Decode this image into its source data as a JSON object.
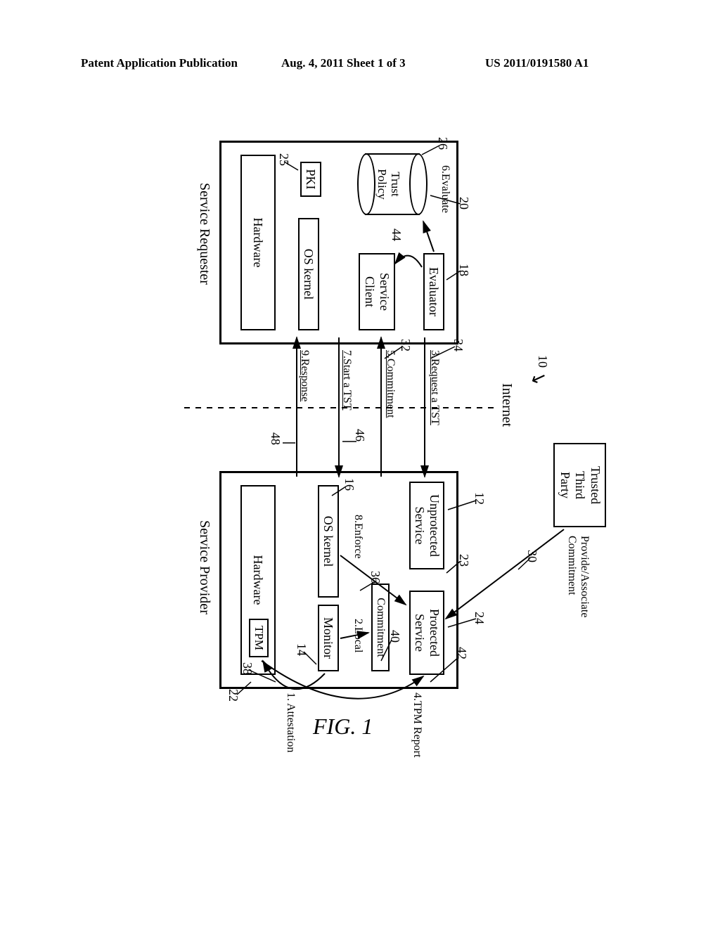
{
  "header": {
    "left": "Patent Application Publication",
    "center": "Aug. 4, 2011  Sheet 1 of 3",
    "right": "US 2011/0191580 A1"
  },
  "figure_label": "FIG. 1",
  "ref_num_10": "10",
  "boxes": {
    "ttp": "Trusted\nThird\nParty",
    "evaluator": "Evaluator",
    "service_client": "Service\nClient",
    "req_os": "OS kernel",
    "req_hw": "Hardware",
    "pki": "PKI",
    "trust_policy": "Trust\nPolicy",
    "unprotected": "Unprotected\nService",
    "protected": "Protected\nService",
    "commitment": "Commitment",
    "sp_os": "OS kernel",
    "monitor": "Monitor",
    "sp_hw": "Hardware",
    "tpm": "TPM"
  },
  "labels": {
    "service_requester": "Service Requester",
    "service_provider": "Service Provider",
    "internet": "Internet"
  },
  "steps": {
    "s1": "1. Attestation",
    "s2": "2.Local",
    "s3": "3.Request a TST",
    "s4": "4.TPM Report",
    "s5": "5.Commitment",
    "s6": "6.Evaluate",
    "s7": "7.Start a TST",
    "s8": "8.Enforce",
    "s9": "9.Response",
    "s30": "Provide/Associate\nCommitment"
  },
  "nums": {
    "n10": "10",
    "n12": "12",
    "n14": "14",
    "n16": "16",
    "n18": "18",
    "n20": "20",
    "n22": "22",
    "n23": "23",
    "n24": "24",
    "n25": "25",
    "n26": "26",
    "n30": "30",
    "n32": "32",
    "n34": "34",
    "n36": "36",
    "n38": "38",
    "n40": "40",
    "n42": "42",
    "n44": "44",
    "n46": "46",
    "n48": "48"
  }
}
